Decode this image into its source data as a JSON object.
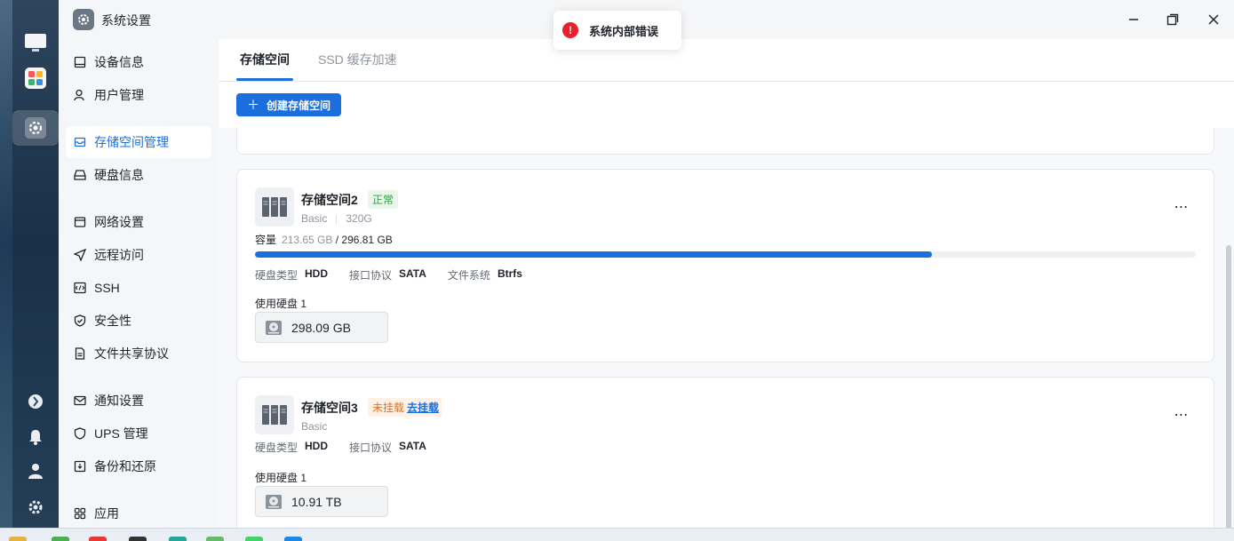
{
  "window": {
    "title": "系统设置"
  },
  "sidebar": {
    "items": [
      {
        "label": "设备信息",
        "icon": "device-icon"
      },
      {
        "label": "用户管理",
        "icon": "user-icon"
      },
      {
        "label": "存储空间管理",
        "icon": "storage-icon",
        "active": true
      },
      {
        "label": "硬盘信息",
        "icon": "hdd-icon"
      },
      {
        "label": "网络设置",
        "icon": "network-icon"
      },
      {
        "label": "远程访问",
        "icon": "remote-icon"
      },
      {
        "label": "SSH",
        "icon": "ssh-icon"
      },
      {
        "label": "安全性",
        "icon": "shield-icon"
      },
      {
        "label": "文件共享协议",
        "icon": "file-share-icon"
      },
      {
        "label": "通知设置",
        "icon": "mail-icon"
      },
      {
        "label": "UPS 管理",
        "icon": "ups-icon"
      },
      {
        "label": "备份和还原",
        "icon": "backup-icon"
      },
      {
        "label": "应用",
        "icon": "apps-icon"
      }
    ]
  },
  "tabs": [
    {
      "label": "存储空间",
      "active": true
    },
    {
      "label": "SSD 缓存加速",
      "active": false
    }
  ],
  "toolbar": {
    "create_label": "创建存储空间",
    "create_icon": "plus-icon"
  },
  "volumes": [
    {
      "name": "存储空间2",
      "status": "正常",
      "type": "Basic",
      "size": "320G",
      "capacity_label": "容量",
      "used": "213.65 GB",
      "total": "/ 296.81 GB",
      "usage_fraction": 0.72,
      "props": [
        {
          "k": "硬盘类型",
          "v": "HDD"
        },
        {
          "k": "接口协议",
          "v": "SATA"
        },
        {
          "k": "文件系统",
          "v": "Btrfs"
        }
      ],
      "disks_label": "使用硬盘 1",
      "disk": "298.09 GB"
    },
    {
      "name": "存储空间3",
      "status": "未挂载",
      "action": "去挂载",
      "type": "Basic",
      "props": [
        {
          "k": "硬盘类型",
          "v": "HDD"
        },
        {
          "k": "接口协议",
          "v": "SATA"
        }
      ],
      "disks_label": "使用硬盘 1",
      "disk": "10.91 TB"
    }
  ],
  "toast": {
    "message": "系统内部错误"
  },
  "colors": {
    "accent": "#1a6fdc",
    "ok": "#2ea043",
    "warn": "#e07024",
    "error": "#e8212d"
  }
}
